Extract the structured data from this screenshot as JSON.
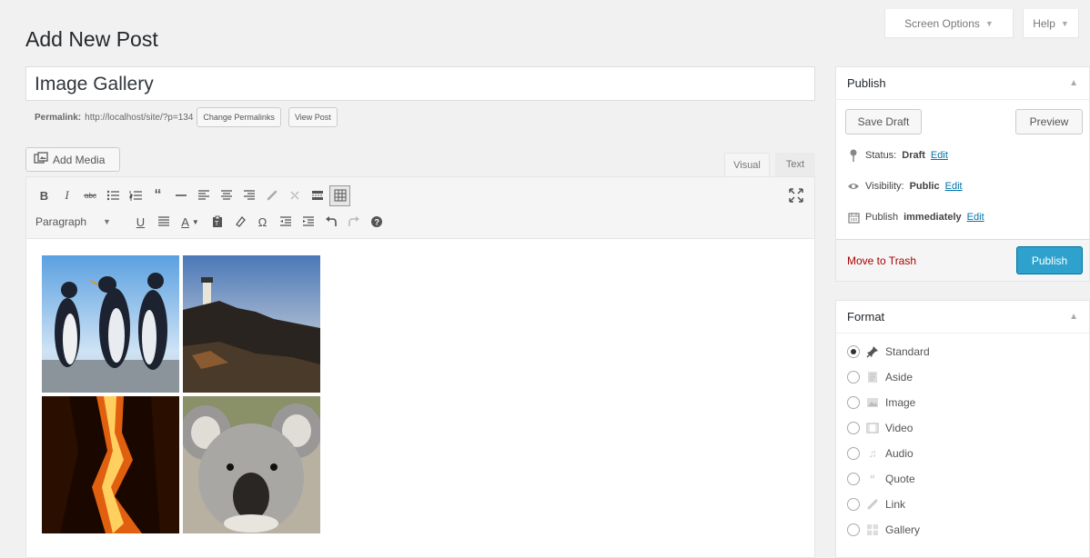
{
  "screen_meta": {
    "screen_options": "Screen Options",
    "help": "Help"
  },
  "page": {
    "title": "Add New Post"
  },
  "post": {
    "title": "Image Gallery"
  },
  "permalink": {
    "label": "Permalink:",
    "url": "http://localhost/site/?p=134",
    "change_button": "Change Permalinks",
    "view_button": "View Post"
  },
  "editor": {
    "add_media": "Add Media",
    "tab_visual": "Visual",
    "tab_text": "Text",
    "format_select": "Paragraph",
    "toolbar_row1": [
      "bold-icon",
      "italic-icon",
      "strikethrough-icon",
      "bulleted-list-icon",
      "numbered-list-icon",
      "blockquote-icon",
      "horizontal-line-icon",
      "align-left-icon",
      "align-center-icon",
      "align-right-icon",
      "insert-link-icon",
      "remove-link-icon",
      "read-more-icon",
      "toolbar-toggle-icon"
    ],
    "toolbar_row2": [
      "underline-icon",
      "justify-icon",
      "text-color-icon",
      "paste-as-text-icon",
      "clear-formatting-icon",
      "special-character-icon",
      "decrease-indent-icon",
      "increase-indent-icon",
      "undo-icon",
      "redo-icon",
      "help-icon"
    ],
    "images": [
      "penguins-image",
      "lighthouse-image",
      "fire-image",
      "koala-image"
    ]
  },
  "publish_box": {
    "title": "Publish",
    "save_draft": "Save Draft",
    "preview": "Preview",
    "status_label": "Status:",
    "status_value": "Draft",
    "visibility_label": "Visibility:",
    "visibility_value": "Public",
    "publish_label": "Publish",
    "publish_value": "immediately",
    "edit": "Edit",
    "move_to_trash": "Move to Trash",
    "publish_button": "Publish"
  },
  "format_box": {
    "title": "Format",
    "options": [
      {
        "label": "Standard",
        "icon": "pin-icon",
        "checked": true
      },
      {
        "label": "Aside",
        "icon": "aside-icon",
        "checked": false
      },
      {
        "label": "Image",
        "icon": "image-icon",
        "checked": false
      },
      {
        "label": "Video",
        "icon": "video-icon",
        "checked": false
      },
      {
        "label": "Audio",
        "icon": "audio-icon",
        "checked": false
      },
      {
        "label": "Quote",
        "icon": "quote-icon",
        "checked": false
      },
      {
        "label": "Link",
        "icon": "link-icon",
        "checked": false
      },
      {
        "label": "Gallery",
        "icon": "gallery-icon",
        "checked": false
      }
    ]
  },
  "colors": {
    "accent": "#2ea2cc",
    "link": "#0073aa",
    "trash": "#aa0000",
    "background": "#f1f1f1"
  }
}
